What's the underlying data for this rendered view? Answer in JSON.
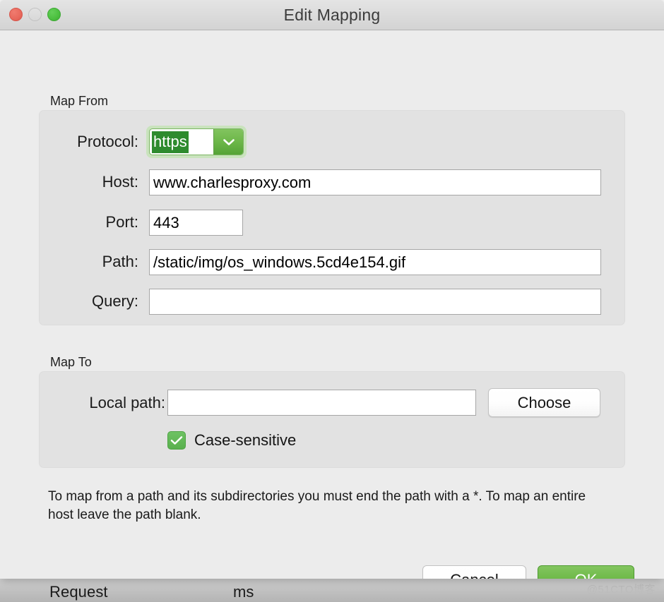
{
  "window": {
    "title": "Edit Mapping",
    "traffic_lights": [
      "close",
      "minimize",
      "zoom"
    ]
  },
  "map_from": {
    "group_title": "Map From",
    "protocol": {
      "label": "Protocol:",
      "value": "https",
      "selected": true,
      "arrow_icon": "chevron-down-icon"
    },
    "host": {
      "label": "Host:",
      "value": "www.charlesproxy.com",
      "placeholder": ""
    },
    "port": {
      "label": "Port:",
      "value": "443",
      "placeholder": ""
    },
    "path": {
      "label": "Path:",
      "value": "/static/img/os_windows.5cd4e154.gif",
      "placeholder": ""
    },
    "query": {
      "label": "Query:",
      "value": "",
      "placeholder": ""
    }
  },
  "map_to": {
    "group_title": "Map To",
    "local_path": {
      "label": "Local path:",
      "value": "",
      "placeholder": ""
    },
    "choose_label": "Choose",
    "case_sensitive": {
      "label": "Case-sensitive",
      "checked": true,
      "check_icon": "checkmark-icon"
    }
  },
  "help_text": "To map from a path and its subdirectories you must end the path with a *. To map an entire host leave the path blank.",
  "footer": {
    "cancel_label": "Cancel",
    "ok_label": "OK"
  },
  "background": {
    "column_request": "Request",
    "column_ms": "ms",
    "watermark": "@51CTO博客"
  },
  "colors": {
    "accent_green": "#5cb85c",
    "selection_green": "#2e8b2e",
    "focus_ring_green": "#c9e3bd",
    "dialog_bg": "#ececec",
    "group_bg": "#e2e2e2",
    "close_red": "#e8685c",
    "zoom_green": "#4cbf3f"
  }
}
